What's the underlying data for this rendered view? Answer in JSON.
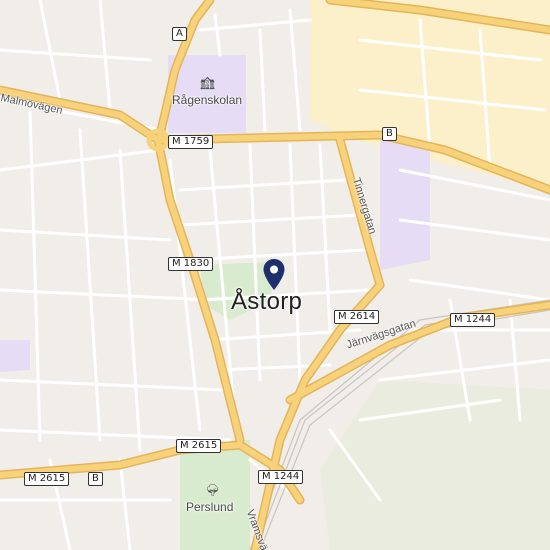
{
  "map": {
    "town_label": "Åstorp",
    "pois": [
      {
        "label": "Rågenskolan",
        "icon": "school-icon"
      },
      {
        "label": "Perslund",
        "icon": "park-icon"
      }
    ],
    "streets": [
      {
        "label": "Malmövägen"
      },
      {
        "label": "Tinnergatan"
      },
      {
        "label": "Järnvägsgatan"
      },
      {
        "label": "Vramsväg"
      }
    ],
    "road_shields": [
      {
        "text": "A"
      },
      {
        "text": "M 1759"
      },
      {
        "text": "B"
      },
      {
        "text": "M 1830"
      },
      {
        "text": "M 2614"
      },
      {
        "text": "M 1244"
      },
      {
        "text": "M 2615"
      },
      {
        "text": "M 2615"
      },
      {
        "text": "B"
      },
      {
        "text": "M 1244"
      }
    ],
    "colors": {
      "background": "#f1ede8",
      "major_road": "#f8d27a",
      "major_road_casing": "#e3b55a",
      "minor_road": "#ffffff",
      "industrial": "#fbf0c9",
      "school_area": "#e6dcf5",
      "park": "#d9ebcf",
      "marker": "#1f2f6e"
    }
  }
}
